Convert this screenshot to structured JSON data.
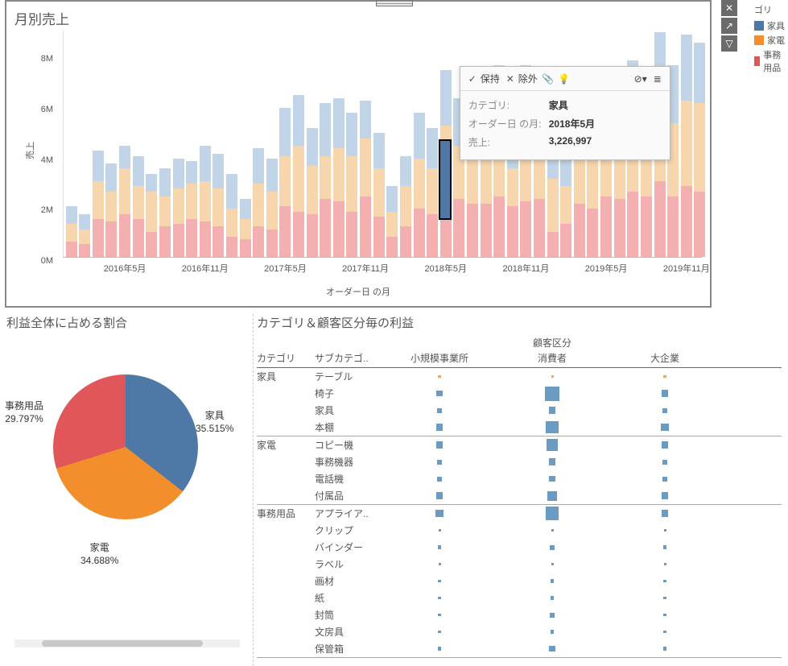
{
  "legend": {
    "title": "ゴリ",
    "items": [
      {
        "label": "家具",
        "color": "#4e79a7"
      },
      {
        "label": "家電",
        "color": "#f28e2b"
      },
      {
        "label": "事務用品",
        "color": "#e15759"
      }
    ]
  },
  "top": {
    "title": "月別売上",
    "xlabel": "オーダー日 の月",
    "ylabel": "売上"
  },
  "tooltip": {
    "keep": "保持",
    "exclude": "除外",
    "rows": [
      {
        "label": "カテゴリ:",
        "value": "家具"
      },
      {
        "label": "オーダー日 の月:",
        "value": "2018年5月"
      },
      {
        "label": "売上:",
        "value": "3,226,997"
      }
    ]
  },
  "pie": {
    "title": "利益全体に占める割合",
    "labels": {
      "furn": {
        "name": "家具",
        "pct": "35.515%"
      },
      "appl": {
        "name": "家電",
        "pct": "34.688%"
      },
      "office": {
        "name": "事務用品",
        "pct": "29.797%"
      }
    }
  },
  "matrix": {
    "title": "カテゴリ＆顧客区分毎の利益",
    "col_group": "顧客区分",
    "col_cat": "カテゴリ",
    "col_sub": "サブカテゴ..",
    "cols": [
      "小規模事業所",
      "消費者",
      "大企業"
    ]
  },
  "chart_data": [
    {
      "type": "bar_stacked",
      "title": "月別売上",
      "xlabel": "オーダー日 の月",
      "ylabel": "売上",
      "ylim": [
        0,
        9000000
      ],
      "x_labels": [
        "2016年5月",
        "2016年11月",
        "2017年5月",
        "2017年11月",
        "2018年5月",
        "2018年11月",
        "2019年5月",
        "2019年11月"
      ],
      "categories": [
        "2016-01",
        "2016-02",
        "2016-03",
        "2016-04",
        "2016-05",
        "2016-06",
        "2016-07",
        "2016-08",
        "2016-09",
        "2016-10",
        "2016-11",
        "2016-12",
        "2017-01",
        "2017-02",
        "2017-03",
        "2017-04",
        "2017-05",
        "2017-06",
        "2017-07",
        "2017-08",
        "2017-09",
        "2017-10",
        "2017-11",
        "2017-12",
        "2018-01",
        "2018-02",
        "2018-03",
        "2018-04",
        "2018-05",
        "2018-06",
        "2018-07",
        "2018-08",
        "2018-09",
        "2018-10",
        "2018-11",
        "2018-12",
        "2019-01",
        "2019-02",
        "2019-03",
        "2019-04",
        "2019-05",
        "2019-06",
        "2019-07",
        "2019-08",
        "2019-09",
        "2019-10",
        "2019-11",
        "2019-12"
      ],
      "series": [
        {
          "name": "事務用品",
          "color": "#e15759",
          "values": [
            600000,
            500000,
            1500000,
            1400000,
            1700000,
            1500000,
            1000000,
            1200000,
            1300000,
            1500000,
            1400000,
            1200000,
            800000,
            700000,
            1200000,
            1100000,
            2000000,
            1800000,
            1700000,
            2300000,
            2200000,
            1800000,
            2400000,
            1600000,
            800000,
            1200000,
            1900000,
            1700000,
            2000000,
            2300000,
            2100000,
            2100000,
            2400000,
            2000000,
            2200000,
            2300000,
            1000000,
            1300000,
            2100000,
            1900000,
            2400000,
            2300000,
            2600000,
            2400000,
            3000000,
            2400000,
            2800000,
            2600000
          ]
        },
        {
          "name": "家具",
          "color": "#f28e2b",
          "values": [
            700000,
            600000,
            1500000,
            1200000,
            1800000,
            1300000,
            1600000,
            1200000,
            1400000,
            1400000,
            1600000,
            1500000,
            1100000,
            800000,
            1700000,
            1500000,
            2000000,
            2600000,
            1900000,
            1700000,
            2100000,
            2200000,
            2300000,
            1900000,
            1000000,
            1600000,
            2000000,
            1800000,
            3200000,
            2100000,
            2600000,
            2200000,
            3000000,
            1500000,
            2900000,
            2900000,
            2100000,
            1500000,
            2500000,
            2300000,
            2500000,
            2600000,
            2800000,
            2400000,
            3400000,
            2900000,
            3400000,
            3500000
          ]
        },
        {
          "name": "家電",
          "color": "#4e79a7",
          "values": [
            700000,
            600000,
            1200000,
            1100000,
            900000,
            1200000,
            700000,
            1100000,
            1200000,
            900000,
            1400000,
            1400000,
            1400000,
            800000,
            1400000,
            1300000,
            1900000,
            2000000,
            1500000,
            2100000,
            2000000,
            1700000,
            1500000,
            1400000,
            1000000,
            1200000,
            1800000,
            1600000,
            2200000,
            1900000,
            1900000,
            2100000,
            2200000,
            900000,
            2500000,
            2300000,
            1900000,
            1400000,
            2200000,
            2100000,
            2100000,
            2400000,
            2400000,
            2200000,
            2500000,
            2300000,
            2600000,
            2400000
          ]
        }
      ],
      "highlight": {
        "category_index": 28,
        "series": "家具",
        "value": 3226997
      }
    },
    {
      "type": "pie",
      "title": "利益全体に占める割合",
      "series": [
        {
          "name": "家具",
          "value": 35.515,
          "color": "#4e79a7"
        },
        {
          "name": "家電",
          "value": 34.688,
          "color": "#f28e2b"
        },
        {
          "name": "事務用品",
          "value": 29.797,
          "color": "#e15759"
        }
      ]
    },
    {
      "type": "heatmap",
      "title": "カテゴリ＆顧客区分毎の利益",
      "col_group_label": "顧客区分",
      "columns": [
        "小規模事業所",
        "消費者",
        "大企業"
      ],
      "row_groups": [
        {
          "category": "家具",
          "rows": [
            {
              "sub": "テーブル",
              "values": [
                -0.6,
                -0.2,
                -0.6
              ]
            },
            {
              "sub": "椅子",
              "values": [
                1.2,
                3.2,
                1.4
              ]
            },
            {
              "sub": "家具",
              "values": [
                1.0,
                1.4,
                1.0
              ]
            },
            {
              "sub": "本棚",
              "values": [
                1.4,
                2.6,
                1.6
              ]
            }
          ]
        },
        {
          "category": "家電",
          "rows": [
            {
              "sub": "コピー機",
              "values": [
                1.4,
                2.4,
                1.4
              ]
            },
            {
              "sub": "事務機器",
              "values": [
                1.0,
                1.4,
                1.0
              ]
            },
            {
              "sub": "電話機",
              "values": [
                1.0,
                1.2,
                1.0
              ]
            },
            {
              "sub": "付属品",
              "values": [
                1.4,
                2.0,
                1.4
              ]
            }
          ]
        },
        {
          "category": "事務用品",
          "rows": [
            {
              "sub": "アプライア..",
              "values": [
                1.6,
                2.8,
                1.4
              ]
            },
            {
              "sub": "クリップ",
              "values": [
                0.5,
                0.5,
                0.5
              ]
            },
            {
              "sub": "バインダー",
              "values": [
                0.8,
                1.0,
                0.8
              ]
            },
            {
              "sub": "ラベル",
              "values": [
                0.5,
                0.5,
                0.5
              ]
            },
            {
              "sub": "画材",
              "values": [
                0.6,
                0.8,
                0.6
              ]
            },
            {
              "sub": "紙",
              "values": [
                0.6,
                0.8,
                0.6
              ]
            },
            {
              "sub": "封筒",
              "values": [
                0.6,
                1.0,
                0.6
              ]
            },
            {
              "sub": "文房具",
              "values": [
                0.6,
                0.8,
                0.6
              ]
            },
            {
              "sub": "保管箱",
              "values": [
                0.8,
                1.2,
                0.8
              ]
            }
          ]
        }
      ]
    }
  ]
}
